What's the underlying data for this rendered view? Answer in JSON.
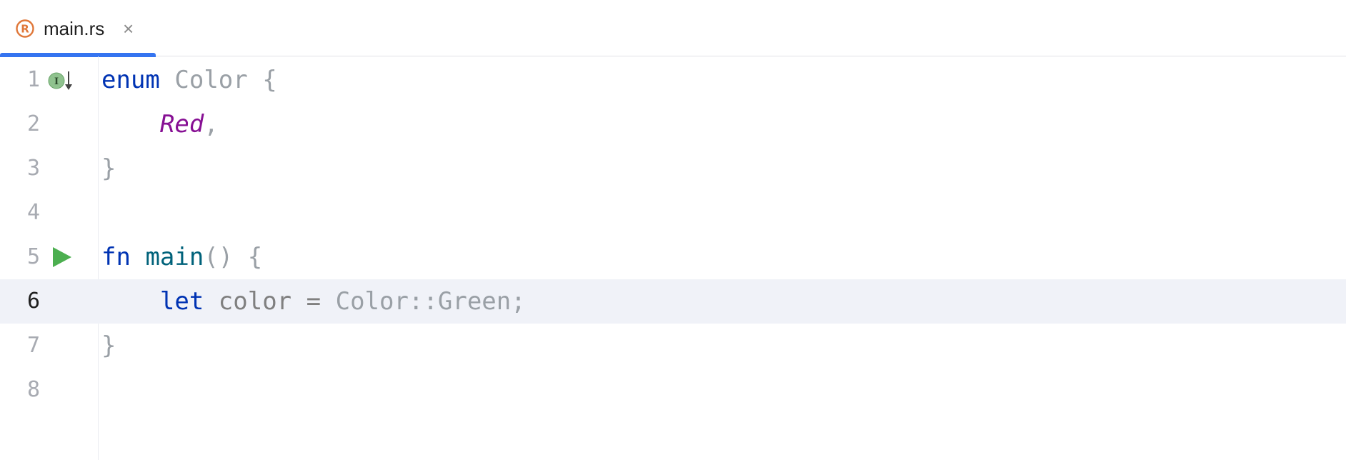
{
  "tab": {
    "label": "main.rs",
    "close": "×",
    "icon": "rust-file-icon",
    "icon_letter": "R",
    "icon_color": "#e0783a",
    "active_color": "#3574f0"
  },
  "gutter": {
    "line_numbers": [
      "1",
      "2",
      "3",
      "4",
      "5",
      "6",
      "7",
      "8"
    ],
    "implemented_marker": "I",
    "implemented_color": "#7fb77e",
    "run_color": "#4caf50"
  },
  "code": {
    "line1": {
      "kw": "enum",
      "name": "Color",
      "brace": "{"
    },
    "line2": {
      "variant": "Red",
      "punct": ","
    },
    "line3": {
      "brace": "}"
    },
    "line5": {
      "kw": "fn",
      "name": "main",
      "parens": "()",
      "brace": "{"
    },
    "line6": {
      "kw": "let",
      "var": "color",
      "eq": "=",
      "path": "Color::Green;"
    },
    "line7": {
      "brace": "}"
    }
  },
  "current_line": "6"
}
